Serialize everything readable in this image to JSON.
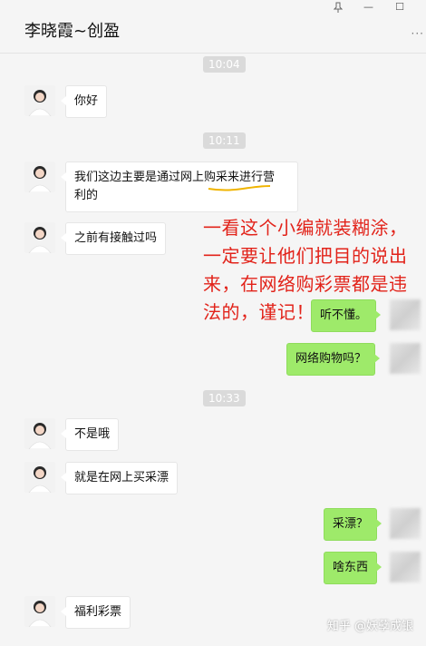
{
  "window": {
    "title": "李晓霞~创盈",
    "pin_icon": "pin-icon",
    "minimize_label": "—",
    "maximize_label": "☐",
    "more_label": "···"
  },
  "timestamps": [
    "10:04",
    "10:11",
    "10:33"
  ],
  "messages": [
    {
      "side": "left",
      "text": "你好"
    },
    {
      "side": "left",
      "text_line1": "我们这边主要是通过网上购采来进行营",
      "text_line2": "利的"
    },
    {
      "side": "left",
      "text": "之前有接触过吗"
    },
    {
      "side": "right",
      "text": "听不懂。"
    },
    {
      "side": "right",
      "text": "网络购物吗？"
    },
    {
      "side": "left",
      "text": "不是哦"
    },
    {
      "side": "left",
      "text": "就是在网上买采漂"
    },
    {
      "side": "right",
      "text": "采漂？"
    },
    {
      "side": "right",
      "text": "啥东西"
    },
    {
      "side": "left",
      "text": "福利彩票"
    }
  ],
  "annotation": {
    "text": "一看这个小编就装糊涂，一定要让他们把目的说出来，在网络购彩票都是违法的，谨记！",
    "color": "#e2231a"
  },
  "watermark": "知乎 @妖孽成银",
  "colors": {
    "right_bubble": "#9eea6a",
    "background": "#f5f5f5"
  }
}
